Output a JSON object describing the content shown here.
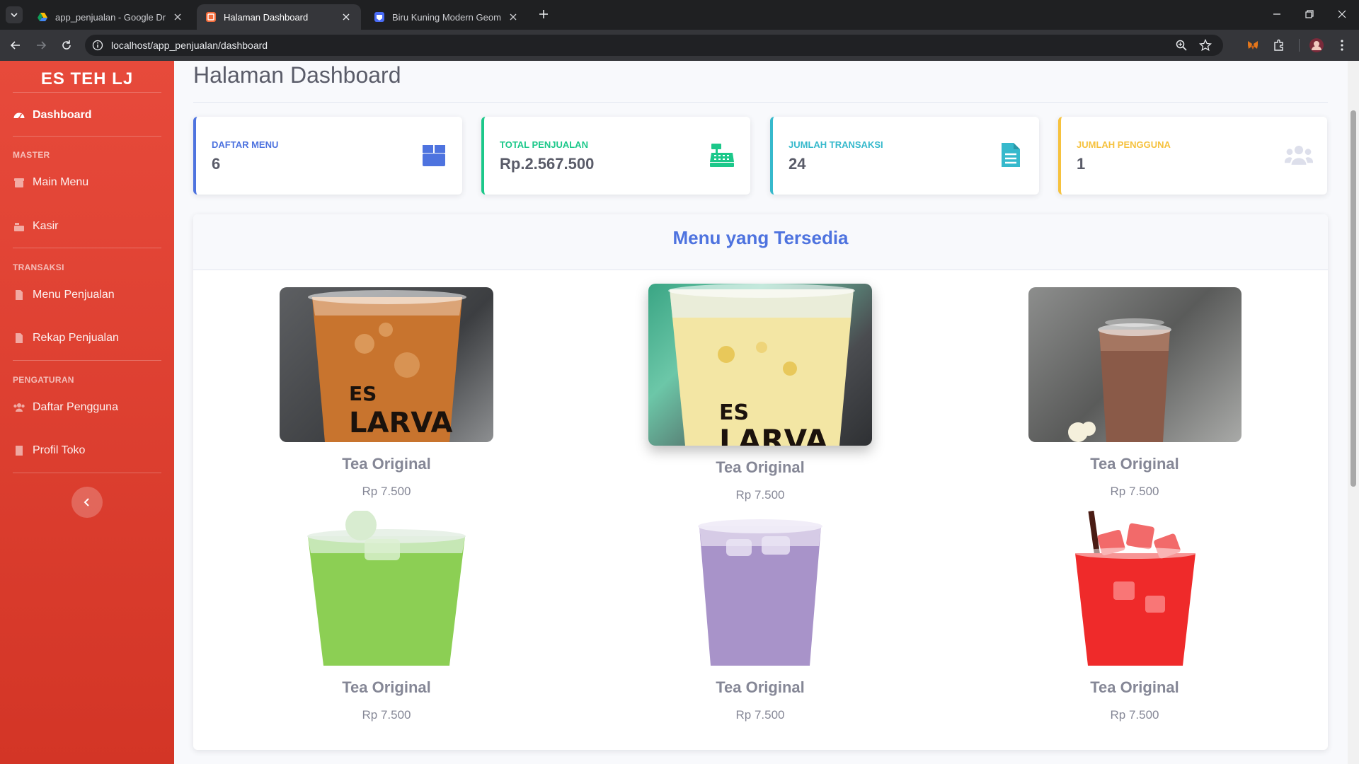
{
  "browser": {
    "tabs": [
      {
        "title": "app_penjualan - Google Drive",
        "icon": "google-drive-icon"
      },
      {
        "title": "Halaman Dashboard",
        "icon": "app-favicon-icon"
      },
      {
        "title": "Biru Kuning Modern Geometris",
        "icon": "canva-icon"
      }
    ],
    "url": "localhost/app_penjualan/dashboard"
  },
  "sidebar": {
    "brand": "ES TEH LJ",
    "dashboard": "Dashboard",
    "sections": {
      "master": "MASTER",
      "transaksi": "TRANSAKSI",
      "pengaturan": "PENGATURAN"
    },
    "items": {
      "main_menu": "Main Menu",
      "kasir": "Kasir",
      "menu_penjualan": "Menu Penjualan",
      "rekap_penjualan": "Rekap Penjualan",
      "daftar_pengguna": "Daftar Pengguna",
      "profil_toko": "Profil Toko"
    }
  },
  "page": {
    "title": "Halaman Dashboard"
  },
  "stats": [
    {
      "label": "DAFTAR MENU",
      "value": "6",
      "color": "#4e73df",
      "icon": "box-icon"
    },
    {
      "label": "TOTAL PENJUALAN",
      "value": "Rp.2.567.500",
      "color": "#1cc88a",
      "icon": "cash-register-icon"
    },
    {
      "label": "JUMLAH TRANSAKSI",
      "value": "24",
      "color": "#36b9cc",
      "icon": "file-icon"
    },
    {
      "label": "JUMLAH PENGGUNA",
      "value": "1",
      "color": "#f6c23e",
      "icon": "users-icon"
    }
  ],
  "menu_card": {
    "title": "Menu yang Tersedia",
    "items": [
      {
        "name": "Tea Original",
        "price": "Rp 7.500",
        "drink_color": "#c8742e"
      },
      {
        "name": "Tea Original",
        "price": "Rp 7.500",
        "drink_color": "#f3e6a4"
      },
      {
        "name": "Tea Original",
        "price": "Rp 7.500",
        "drink_color": "#8a5a48"
      },
      {
        "name": "Tea Original",
        "price": "Rp 7.500",
        "drink_color": "#8ccf54"
      },
      {
        "name": "Tea Original",
        "price": "Rp 7.500",
        "drink_color": "#a893c9"
      },
      {
        "name": "Tea Original",
        "price": "Rp 7.500",
        "drink_color": "#ef2a2a"
      }
    ]
  }
}
